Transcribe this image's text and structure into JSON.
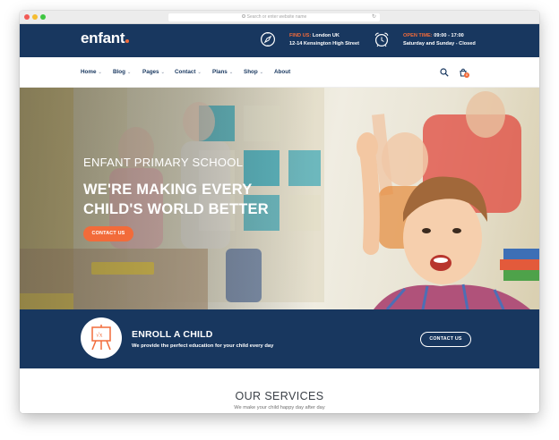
{
  "browser": {
    "url_placeholder": "Search or enter website name",
    "reload_icon": "reload-icon"
  },
  "header": {
    "logo": "enfant",
    "find_us": {
      "label": "FIND US:",
      "line1": "London UK",
      "line2": "12-14 Kensington High Street",
      "icon": "compass-icon"
    },
    "open_time": {
      "label": "OPEN TIME:",
      "line1": "09:00 - 17:00",
      "line2": "Saturday and Sunday - Closed",
      "icon": "alarm-clock-icon"
    }
  },
  "nav": {
    "items": [
      {
        "label": "Home",
        "has_dropdown": true
      },
      {
        "label": "Blog",
        "has_dropdown": true
      },
      {
        "label": "Pages",
        "has_dropdown": true
      },
      {
        "label": "Contact",
        "has_dropdown": true
      },
      {
        "label": "Plans",
        "has_dropdown": true
      },
      {
        "label": "Shop",
        "has_dropdown": true
      },
      {
        "label": "About",
        "has_dropdown": false
      }
    ],
    "search_icon": "search-icon",
    "cart_icon": "cart-icon",
    "cart_count": "0"
  },
  "hero": {
    "subtitle": "ENFANT PRIMARY SCHOOL",
    "title_line1": "WE'RE MAKING EVERY",
    "title_line2": "CHILD'S WORLD BETTER",
    "cta_label": "CONTACT US"
  },
  "enroll": {
    "icon": "easel-board-icon",
    "title": "ENROLL A CHILD",
    "subtitle": "We provide the perfect education for your child every day",
    "button_label": "CONTACT US"
  },
  "services": {
    "title": "OUR SERVICES",
    "subtitle": "We make your child happy day after day"
  },
  "colors": {
    "primary": "#18375f",
    "accent": "#f26b3a",
    "background": "#ffffff"
  }
}
